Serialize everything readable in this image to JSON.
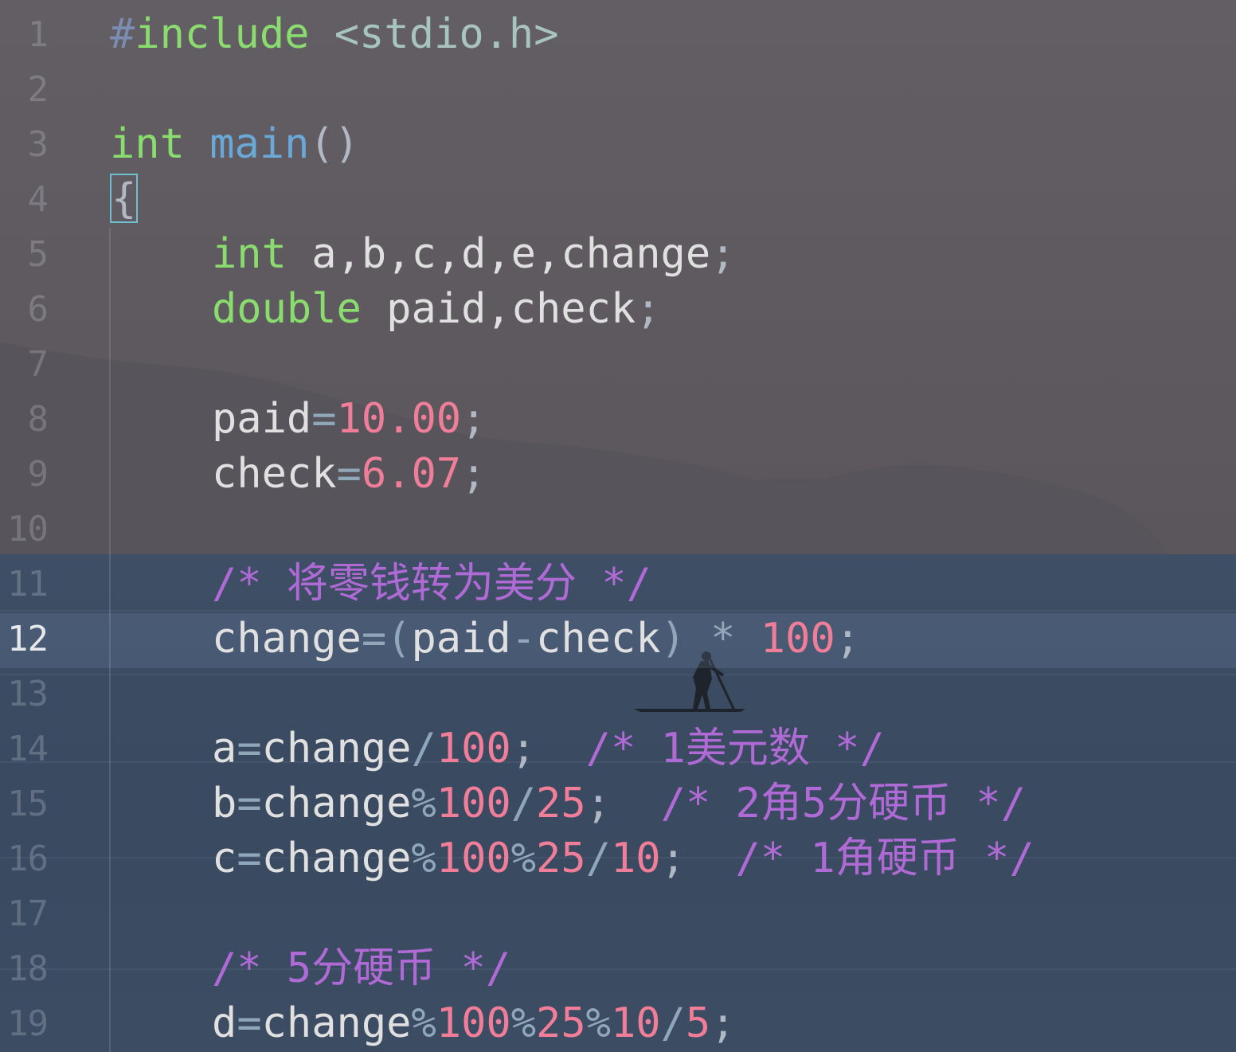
{
  "editor": {
    "current_line": 12,
    "lines": [
      {
        "number": "1",
        "indent": 0,
        "tokens": [
          {
            "t": "#",
            "c": "pp"
          },
          {
            "t": "include",
            "c": "kw"
          },
          {
            "t": " ",
            "c": "id"
          },
          {
            "t": "<stdio.h>",
            "c": "str"
          }
        ]
      },
      {
        "number": "2",
        "indent": 0,
        "tokens": []
      },
      {
        "number": "3",
        "indent": 0,
        "tokens": [
          {
            "t": "int",
            "c": "kw"
          },
          {
            "t": " ",
            "c": "id"
          },
          {
            "t": "main",
            "c": "fn"
          },
          {
            "t": "()",
            "c": "punc"
          }
        ]
      },
      {
        "number": "4",
        "indent": 0,
        "tokens": [
          {
            "t": "{",
            "c": "punc",
            "box": true
          }
        ]
      },
      {
        "number": "5",
        "indent": 1,
        "tokens": [
          {
            "t": "int",
            "c": "kw"
          },
          {
            "t": " a,b,c,d,e,change",
            "c": "id"
          },
          {
            "t": ";",
            "c": "punc"
          }
        ]
      },
      {
        "number": "6",
        "indent": 1,
        "tokens": [
          {
            "t": "double",
            "c": "kw"
          },
          {
            "t": " paid,check",
            "c": "id"
          },
          {
            "t": ";",
            "c": "punc"
          }
        ]
      },
      {
        "number": "7",
        "indent": 1,
        "tokens": []
      },
      {
        "number": "8",
        "indent": 1,
        "tokens": [
          {
            "t": "paid",
            "c": "id"
          },
          {
            "t": "=",
            "c": "op"
          },
          {
            "t": "10.00",
            "c": "num"
          },
          {
            "t": ";",
            "c": "punc"
          }
        ]
      },
      {
        "number": "9",
        "indent": 1,
        "tokens": [
          {
            "t": "check",
            "c": "id"
          },
          {
            "t": "=",
            "c": "op"
          },
          {
            "t": "6.07",
            "c": "num"
          },
          {
            "t": ";",
            "c": "punc"
          }
        ]
      },
      {
        "number": "10",
        "indent": 1,
        "tokens": []
      },
      {
        "number": "11",
        "indent": 1,
        "tokens": [
          {
            "t": "/* 将零钱转为美分 */",
            "c": "cmt"
          }
        ]
      },
      {
        "number": "12",
        "indent": 1,
        "tokens": [
          {
            "t": "change",
            "c": "id"
          },
          {
            "t": "=",
            "c": "op"
          },
          {
            "t": "(",
            "c": "op"
          },
          {
            "t": "paid",
            "c": "id"
          },
          {
            "t": "-",
            "c": "op"
          },
          {
            "t": "check",
            "c": "id"
          },
          {
            "t": ")",
            "c": "op"
          },
          {
            "t": " * ",
            "c": "op"
          },
          {
            "t": "100",
            "c": "num"
          },
          {
            "t": ";",
            "c": "punc"
          }
        ]
      },
      {
        "number": "13",
        "indent": 1,
        "tokens": []
      },
      {
        "number": "14",
        "indent": 1,
        "tokens": [
          {
            "t": "a",
            "c": "id"
          },
          {
            "t": "=",
            "c": "op"
          },
          {
            "t": "change",
            "c": "id"
          },
          {
            "t": "/",
            "c": "op"
          },
          {
            "t": "100",
            "c": "num"
          },
          {
            "t": ";",
            "c": "punc"
          },
          {
            "t": "  ",
            "c": "id"
          },
          {
            "t": "/* 1美元数 */",
            "c": "cmt"
          }
        ]
      },
      {
        "number": "15",
        "indent": 1,
        "tokens": [
          {
            "t": "b",
            "c": "id"
          },
          {
            "t": "=",
            "c": "op"
          },
          {
            "t": "change",
            "c": "id"
          },
          {
            "t": "%",
            "c": "op"
          },
          {
            "t": "100",
            "c": "num"
          },
          {
            "t": "/",
            "c": "op"
          },
          {
            "t": "25",
            "c": "num"
          },
          {
            "t": ";",
            "c": "punc"
          },
          {
            "t": "  ",
            "c": "id"
          },
          {
            "t": "/* 2角5分硬币 */",
            "c": "cmt"
          }
        ]
      },
      {
        "number": "16",
        "indent": 1,
        "tokens": [
          {
            "t": "c",
            "c": "id"
          },
          {
            "t": "=",
            "c": "op"
          },
          {
            "t": "change",
            "c": "id"
          },
          {
            "t": "%",
            "c": "op"
          },
          {
            "t": "100",
            "c": "num"
          },
          {
            "t": "%",
            "c": "op"
          },
          {
            "t": "25",
            "c": "num"
          },
          {
            "t": "/",
            "c": "op"
          },
          {
            "t": "10",
            "c": "num"
          },
          {
            "t": ";",
            "c": "punc"
          },
          {
            "t": "  ",
            "c": "id"
          },
          {
            "t": "/* 1角硬币 */",
            "c": "cmt"
          }
        ]
      },
      {
        "number": "17",
        "indent": 1,
        "tokens": []
      },
      {
        "number": "18",
        "indent": 1,
        "tokens": [
          {
            "t": "/* 5分硬币 */",
            "c": "cmt"
          }
        ]
      },
      {
        "number": "19",
        "indent": 1,
        "tokens": [
          {
            "t": "d",
            "c": "id"
          },
          {
            "t": "=",
            "c": "op"
          },
          {
            "t": "change",
            "c": "id"
          },
          {
            "t": "%",
            "c": "op"
          },
          {
            "t": "100",
            "c": "num"
          },
          {
            "t": "%",
            "c": "op"
          },
          {
            "t": "25",
            "c": "num"
          },
          {
            "t": "%",
            "c": "op"
          },
          {
            "t": "10",
            "c": "num"
          },
          {
            "t": "/",
            "c": "op"
          },
          {
            "t": "5",
            "c": "num"
          },
          {
            "t": ";",
            "c": "punc"
          }
        ]
      }
    ]
  },
  "colors": {
    "keyword": "#8adc6e",
    "function": "#6aa8d8",
    "number": "#f07e98",
    "comment": "#b06ad6",
    "string": "#a7c4c0",
    "preprocessor": "#7a8db0",
    "identifier": "#e0e0e0",
    "operator": "#8fa7b8"
  }
}
